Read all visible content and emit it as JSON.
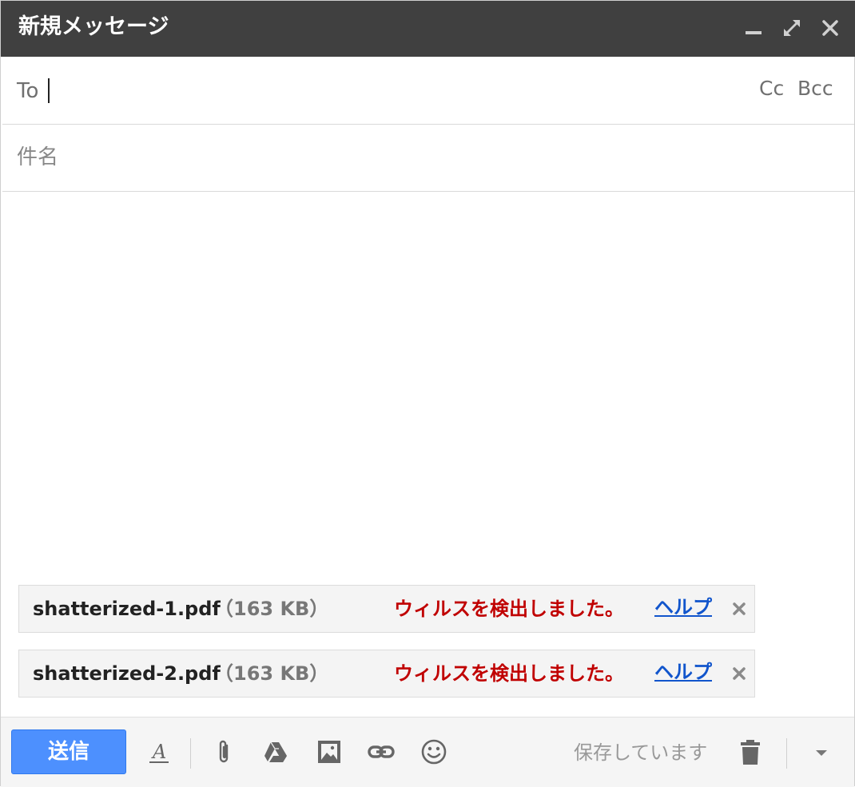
{
  "window": {
    "title": "新規メッセージ"
  },
  "recipients": {
    "to_label": "To",
    "to_value": "",
    "cc_label": "Cc",
    "bcc_label": "Bcc"
  },
  "subject": {
    "placeholder": "件名",
    "value": ""
  },
  "attachments": [
    {
      "name": "shatterized-1.pdf",
      "size": "（163 KB）",
      "status": "ウィルスを検出しました。",
      "help": "ヘルプ"
    },
    {
      "name": "shatterized-2.pdf",
      "size": "（163 KB）",
      "status": "ウィルスを検出しました。",
      "help": "ヘルプ"
    }
  ],
  "toolbar": {
    "send_label": "送信",
    "saving_status": "保存しています",
    "icons": [
      "formatting-icon",
      "attach-icon",
      "drive-icon",
      "photo-icon",
      "link-icon",
      "emoji-icon",
      "trash-icon",
      "more-options-icon"
    ]
  },
  "colors": {
    "title_bar": "#404040",
    "send_button": "#4d90fe",
    "virus_warning": "#c00000",
    "link": "#1155cc"
  }
}
